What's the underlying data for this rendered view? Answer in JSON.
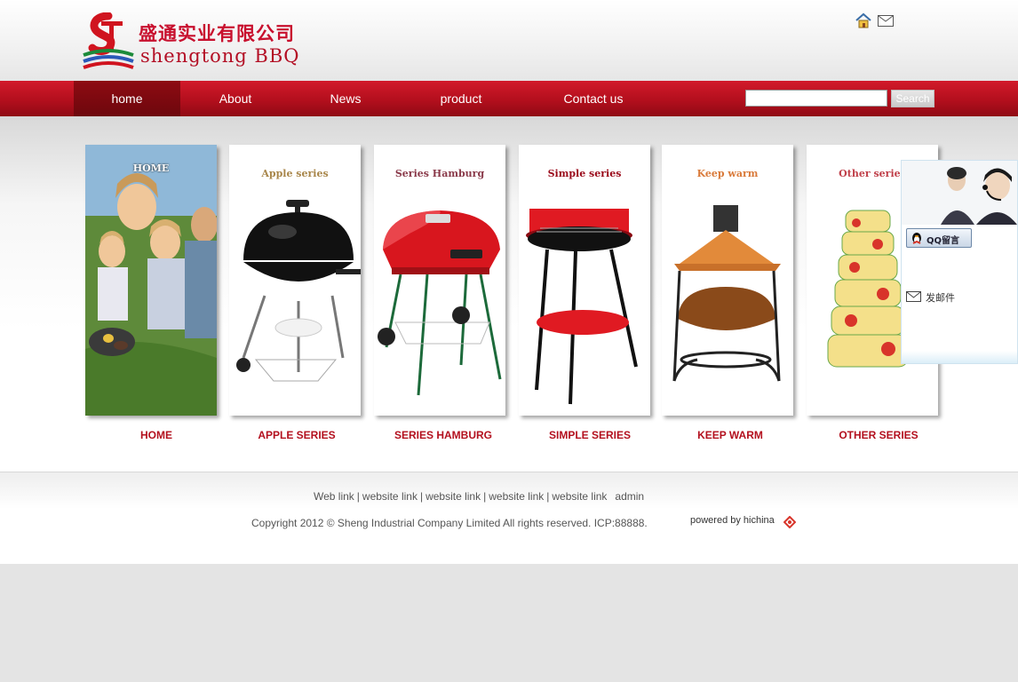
{
  "header": {
    "logo_cn": "盛通实业有限公司",
    "logo_en": "shengtong BBQ",
    "icons": [
      "home-icon",
      "mail-icon"
    ]
  },
  "nav": {
    "items": [
      {
        "label": "home",
        "active": true
      },
      {
        "label": "About"
      },
      {
        "label": "News"
      },
      {
        "label": "product"
      },
      {
        "label": "Contact us"
      }
    ],
    "search": {
      "value": "",
      "button_label": "Search"
    }
  },
  "gallery": {
    "panels": [
      {
        "title": "HOME",
        "caption": "HOME",
        "title_color": "#ffffff"
      },
      {
        "title": "Apple series",
        "caption": "APPLE SERIES",
        "title_color": "#a8864a"
      },
      {
        "title": "Series Hamburg",
        "caption": "SERIES HAMBURG",
        "title_color": "#8a3a4a"
      },
      {
        "title": "Simple series",
        "caption": "SIMPLE SERIES",
        "title_color": "#9a0a1a"
      },
      {
        "title": "Keep warm",
        "caption": "KEEP WARM",
        "title_color": "#d97a3a"
      },
      {
        "title": "Other series",
        "caption": "OTHER SERIES",
        "title_color": "#c0404a"
      }
    ]
  },
  "service": {
    "qq_label": "QQ留言",
    "email_label": "发邮件"
  },
  "footer": {
    "links": [
      "Web link",
      "website link",
      "website link",
      "website link",
      "website link"
    ],
    "admin": "admin",
    "copyright": "Copyright 2012 ©  Sheng Industrial Company Limited  All rights reserved.   ICP:88888.",
    "powered": "powered by hichina"
  },
  "colors": {
    "brand_red": "#b30f1d",
    "nav_active": "#7a0810",
    "caption_red": "#b3101e"
  }
}
